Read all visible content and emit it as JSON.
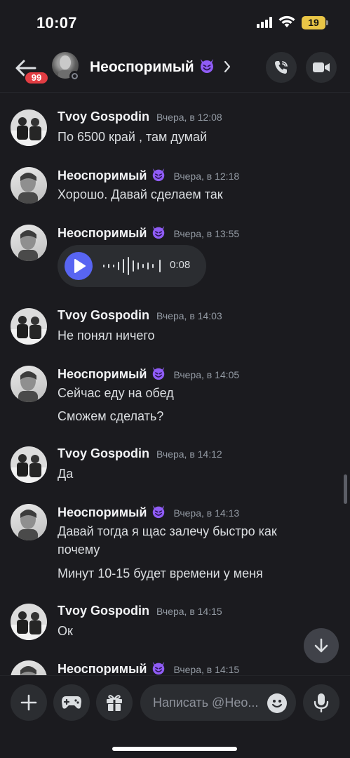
{
  "status_bar": {
    "time": "10:07",
    "battery": "19"
  },
  "header": {
    "title": "Неоспоримый",
    "unread_badge": "99"
  },
  "messages": [
    {
      "author": "Tvoy Gospodin",
      "time": "Вчера, в 12:08",
      "lines": [
        "По 6500 край , там думай"
      ]
    },
    {
      "author": "Неоспоримый",
      "time": "Вчера, в 12:18",
      "lines": [
        "Хорошо. Давай сделаем так"
      ]
    },
    {
      "author": "Неоспоримый",
      "time": "Вчера, в 13:55",
      "voice_duration": "0:08"
    },
    {
      "author": "Tvoy Gospodin",
      "time": "Вчера, в 14:03",
      "lines": [
        "Не понял ничего"
      ]
    },
    {
      "author": "Неоспоримый",
      "time": "Вчера, в 14:05",
      "lines": [
        "Сейчас еду на обед",
        "Сможем сделать?"
      ]
    },
    {
      "author": "Tvoy Gospodin",
      "time": "Вчера, в 14:12",
      "lines": [
        "Да"
      ]
    },
    {
      "author": "Неоспоримый",
      "time": "Вчера, в 14:13",
      "lines": [
        "Давай тогда я щас залечу быстро как почему",
        "Минут 10-15 будет времени у меня"
      ]
    },
    {
      "author": "Tvoy Gospodin",
      "time": "Вчера, в 14:15",
      "lines": [
        "Ок"
      ]
    },
    {
      "author": "Неоспоримый",
      "time": "Вчера, в 14:15"
    }
  ],
  "composer": {
    "placeholder": "Написать @Нео..."
  },
  "icons": {
    "back": "arrow-left-icon",
    "call": "phone-call-icon",
    "video": "video-camera-icon",
    "add": "plus-icon",
    "games": "gamepad-icon",
    "gift": "gift-icon",
    "emoji": "smile-icon",
    "mic": "microphone-icon",
    "jump": "arrow-down-icon",
    "devil_emoji": "smiling-devil-emoji"
  },
  "colors": {
    "accent": "#5865f2",
    "badge": "#e23d43",
    "devil": "#8f5cf5"
  }
}
